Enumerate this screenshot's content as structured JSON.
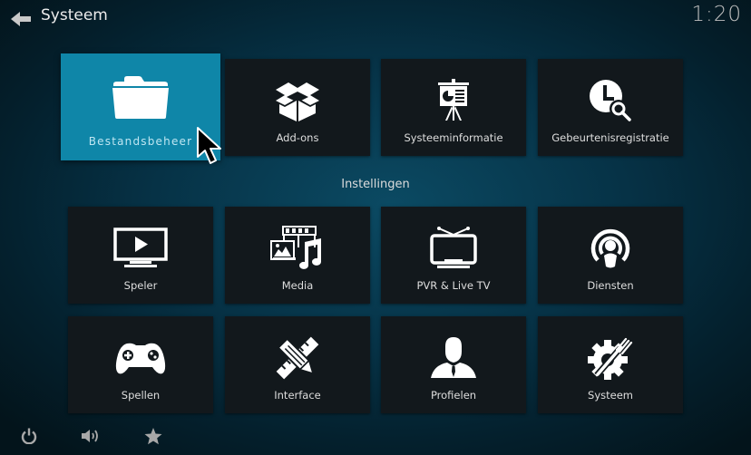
{
  "header": {
    "back_icon": "arrow-left-icon",
    "title": "Systeem",
    "clock": "1:20"
  },
  "top_row": [
    {
      "label": "Bestandsbeheer",
      "icon": "folder-icon",
      "focused": true
    },
    {
      "label": "Add-ons",
      "icon": "open-box-icon",
      "focused": false
    },
    {
      "label": "Systeeminformatie",
      "icon": "presentation-board-icon",
      "focused": false
    },
    {
      "label": "Gebeurtenisregistratie",
      "icon": "clock-search-icon",
      "focused": false
    }
  ],
  "section": {
    "label": "Instellingen"
  },
  "settings_grid": [
    {
      "label": "Speler",
      "icon": "monitor-play-icon"
    },
    {
      "label": "Media",
      "icon": "media-film-photo-music-icon"
    },
    {
      "label": "PVR & Live TV",
      "icon": "tv-antenna-icon"
    },
    {
      "label": "Diensten",
      "icon": "podcast-broadcast-icon"
    },
    {
      "label": "Spellen",
      "icon": "gamepad-icon"
    },
    {
      "label": "Interface",
      "icon": "pencil-ruler-icon"
    },
    {
      "label": "Profielen",
      "icon": "user-profile-icon"
    },
    {
      "label": "Systeem",
      "icon": "gear-wrench-icon"
    }
  ],
  "bottom_bar": [
    {
      "icon": "power-icon"
    },
    {
      "icon": "volume-icon"
    },
    {
      "icon": "star-favourites-icon"
    }
  ],
  "colors": {
    "focus_tile": "#0f86a8",
    "tile_bg": "#12181c",
    "background": "#063246"
  }
}
